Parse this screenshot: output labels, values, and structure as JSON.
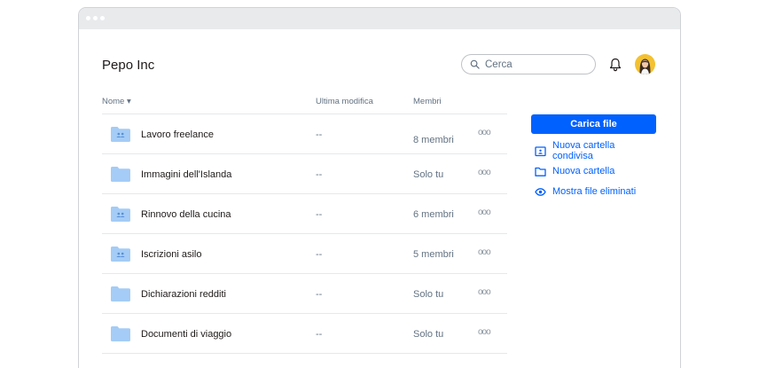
{
  "header": {
    "title": "Pepo Inc",
    "search_placeholder": "Cerca"
  },
  "table": {
    "columns": {
      "name": "Nome ▾",
      "modified": "Ultima modifica",
      "members": "Membri"
    },
    "rows": [
      {
        "name": "Lavoro freelance",
        "modified": "--",
        "members": "8 membri",
        "type": "shared-folder",
        "more": "ooo"
      },
      {
        "name": "Immagini dell'Islanda",
        "modified": "--",
        "members": "Solo tu",
        "type": "folder",
        "more": "ooo"
      },
      {
        "name": "Rinnovo della cucina",
        "modified": "--",
        "members": "6 membri",
        "type": "shared-folder",
        "more": "ooo"
      },
      {
        "name": "Iscrizioni asilo",
        "modified": "--",
        "members": "5 membri",
        "type": "shared-folder",
        "more": "ooo"
      },
      {
        "name": "Dichiarazioni redditi",
        "modified": "--",
        "members": "Solo tu",
        "type": "folder",
        "more": "ooo"
      },
      {
        "name": "Documenti di viaggio",
        "modified": "--",
        "members": "Solo tu",
        "type": "folder",
        "more": "ooo"
      }
    ]
  },
  "sidebar": {
    "upload_label": "Carica file",
    "actions": [
      {
        "label": "Nuova cartella condivisa",
        "icon": "shared-folder-icon"
      },
      {
        "label": "Nuova cartella",
        "icon": "folder-icon"
      },
      {
        "label": "Mostra file eliminati",
        "icon": "eye-icon"
      }
    ]
  },
  "colors": {
    "accent": "#0061fe",
    "folder": "#a4ccf6",
    "avatar_bg": "#f3c131"
  }
}
